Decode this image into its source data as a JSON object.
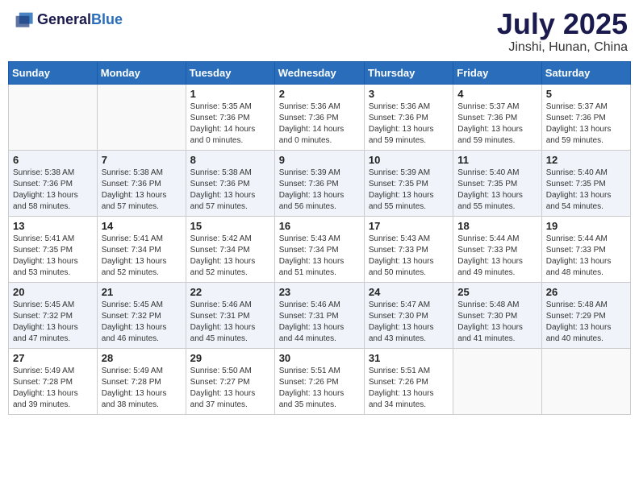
{
  "header": {
    "logo_general": "General",
    "logo_blue": "Blue",
    "month": "July 2025",
    "location": "Jinshi, Hunan, China"
  },
  "weekdays": [
    "Sunday",
    "Monday",
    "Tuesday",
    "Wednesday",
    "Thursday",
    "Friday",
    "Saturday"
  ],
  "weeks": [
    [
      {
        "day": "",
        "info": ""
      },
      {
        "day": "",
        "info": ""
      },
      {
        "day": "1",
        "info": "Sunrise: 5:35 AM\nSunset: 7:36 PM\nDaylight: 14 hours\nand 0 minutes."
      },
      {
        "day": "2",
        "info": "Sunrise: 5:36 AM\nSunset: 7:36 PM\nDaylight: 14 hours\nand 0 minutes."
      },
      {
        "day": "3",
        "info": "Sunrise: 5:36 AM\nSunset: 7:36 PM\nDaylight: 13 hours\nand 59 minutes."
      },
      {
        "day": "4",
        "info": "Sunrise: 5:37 AM\nSunset: 7:36 PM\nDaylight: 13 hours\nand 59 minutes."
      },
      {
        "day": "5",
        "info": "Sunrise: 5:37 AM\nSunset: 7:36 PM\nDaylight: 13 hours\nand 59 minutes."
      }
    ],
    [
      {
        "day": "6",
        "info": "Sunrise: 5:38 AM\nSunset: 7:36 PM\nDaylight: 13 hours\nand 58 minutes."
      },
      {
        "day": "7",
        "info": "Sunrise: 5:38 AM\nSunset: 7:36 PM\nDaylight: 13 hours\nand 57 minutes."
      },
      {
        "day": "8",
        "info": "Sunrise: 5:38 AM\nSunset: 7:36 PM\nDaylight: 13 hours\nand 57 minutes."
      },
      {
        "day": "9",
        "info": "Sunrise: 5:39 AM\nSunset: 7:36 PM\nDaylight: 13 hours\nand 56 minutes."
      },
      {
        "day": "10",
        "info": "Sunrise: 5:39 AM\nSunset: 7:35 PM\nDaylight: 13 hours\nand 55 minutes."
      },
      {
        "day": "11",
        "info": "Sunrise: 5:40 AM\nSunset: 7:35 PM\nDaylight: 13 hours\nand 55 minutes."
      },
      {
        "day": "12",
        "info": "Sunrise: 5:40 AM\nSunset: 7:35 PM\nDaylight: 13 hours\nand 54 minutes."
      }
    ],
    [
      {
        "day": "13",
        "info": "Sunrise: 5:41 AM\nSunset: 7:35 PM\nDaylight: 13 hours\nand 53 minutes."
      },
      {
        "day": "14",
        "info": "Sunrise: 5:41 AM\nSunset: 7:34 PM\nDaylight: 13 hours\nand 52 minutes."
      },
      {
        "day": "15",
        "info": "Sunrise: 5:42 AM\nSunset: 7:34 PM\nDaylight: 13 hours\nand 52 minutes."
      },
      {
        "day": "16",
        "info": "Sunrise: 5:43 AM\nSunset: 7:34 PM\nDaylight: 13 hours\nand 51 minutes."
      },
      {
        "day": "17",
        "info": "Sunrise: 5:43 AM\nSunset: 7:33 PM\nDaylight: 13 hours\nand 50 minutes."
      },
      {
        "day": "18",
        "info": "Sunrise: 5:44 AM\nSunset: 7:33 PM\nDaylight: 13 hours\nand 49 minutes."
      },
      {
        "day": "19",
        "info": "Sunrise: 5:44 AM\nSunset: 7:33 PM\nDaylight: 13 hours\nand 48 minutes."
      }
    ],
    [
      {
        "day": "20",
        "info": "Sunrise: 5:45 AM\nSunset: 7:32 PM\nDaylight: 13 hours\nand 47 minutes."
      },
      {
        "day": "21",
        "info": "Sunrise: 5:45 AM\nSunset: 7:32 PM\nDaylight: 13 hours\nand 46 minutes."
      },
      {
        "day": "22",
        "info": "Sunrise: 5:46 AM\nSunset: 7:31 PM\nDaylight: 13 hours\nand 45 minutes."
      },
      {
        "day": "23",
        "info": "Sunrise: 5:46 AM\nSunset: 7:31 PM\nDaylight: 13 hours\nand 44 minutes."
      },
      {
        "day": "24",
        "info": "Sunrise: 5:47 AM\nSunset: 7:30 PM\nDaylight: 13 hours\nand 43 minutes."
      },
      {
        "day": "25",
        "info": "Sunrise: 5:48 AM\nSunset: 7:30 PM\nDaylight: 13 hours\nand 41 minutes."
      },
      {
        "day": "26",
        "info": "Sunrise: 5:48 AM\nSunset: 7:29 PM\nDaylight: 13 hours\nand 40 minutes."
      }
    ],
    [
      {
        "day": "27",
        "info": "Sunrise: 5:49 AM\nSunset: 7:28 PM\nDaylight: 13 hours\nand 39 minutes."
      },
      {
        "day": "28",
        "info": "Sunrise: 5:49 AM\nSunset: 7:28 PM\nDaylight: 13 hours\nand 38 minutes."
      },
      {
        "day": "29",
        "info": "Sunrise: 5:50 AM\nSunset: 7:27 PM\nDaylight: 13 hours\nand 37 minutes."
      },
      {
        "day": "30",
        "info": "Sunrise: 5:51 AM\nSunset: 7:26 PM\nDaylight: 13 hours\nand 35 minutes."
      },
      {
        "day": "31",
        "info": "Sunrise: 5:51 AM\nSunset: 7:26 PM\nDaylight: 13 hours\nand 34 minutes."
      },
      {
        "day": "",
        "info": ""
      },
      {
        "day": "",
        "info": ""
      }
    ]
  ]
}
